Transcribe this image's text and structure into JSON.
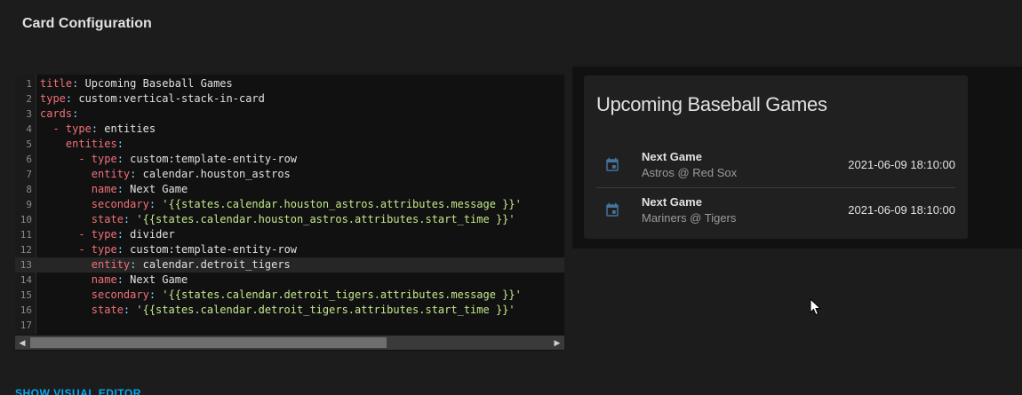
{
  "dialog": {
    "title": "Card Configuration"
  },
  "editor": {
    "lines": [
      {
        "n": "1",
        "tokens": [
          [
            "k",
            "title"
          ],
          [
            "p",
            ": "
          ],
          [
            "v",
            "Upcoming Baseball Games"
          ]
        ]
      },
      {
        "n": "2",
        "tokens": [
          [
            "k",
            "type"
          ],
          [
            "p",
            ": "
          ],
          [
            "v",
            "custom:vertical-stack-in-card"
          ]
        ]
      },
      {
        "n": "3",
        "tokens": [
          [
            "k",
            "cards"
          ],
          [
            "p",
            ":"
          ]
        ]
      },
      {
        "n": "4",
        "tokens": [
          [
            "v",
            "  "
          ],
          [
            "k",
            "- type"
          ],
          [
            "p",
            ": "
          ],
          [
            "v",
            "entities"
          ]
        ]
      },
      {
        "n": "5",
        "tokens": [
          [
            "v",
            "    "
          ],
          [
            "k",
            "entities"
          ],
          [
            "p",
            ":"
          ]
        ]
      },
      {
        "n": "6",
        "tokens": [
          [
            "v",
            "      "
          ],
          [
            "k",
            "- type"
          ],
          [
            "p",
            ": "
          ],
          [
            "v",
            "custom:template-entity-row"
          ]
        ]
      },
      {
        "n": "7",
        "tokens": [
          [
            "v",
            "        "
          ],
          [
            "k",
            "entity"
          ],
          [
            "p",
            ": "
          ],
          [
            "v",
            "calendar.houston_astros"
          ]
        ]
      },
      {
        "n": "8",
        "tokens": [
          [
            "v",
            "        "
          ],
          [
            "k",
            "name"
          ],
          [
            "p",
            ": "
          ],
          [
            "v",
            "Next Game"
          ]
        ]
      },
      {
        "n": "9",
        "tokens": [
          [
            "v",
            "        "
          ],
          [
            "k",
            "secondary"
          ],
          [
            "p",
            ": "
          ],
          [
            "s",
            "'{{states.calendar.houston_astros.attributes.message }}'"
          ]
        ]
      },
      {
        "n": "10",
        "tokens": [
          [
            "v",
            "        "
          ],
          [
            "k",
            "state"
          ],
          [
            "p",
            ": "
          ],
          [
            "s",
            "'{{states.calendar.houston_astros.attributes.start_time }}'"
          ]
        ]
      },
      {
        "n": "11",
        "tokens": [
          [
            "v",
            "      "
          ],
          [
            "k",
            "- type"
          ],
          [
            "p",
            ": "
          ],
          [
            "v",
            "divider"
          ]
        ]
      },
      {
        "n": "12",
        "tokens": [
          [
            "v",
            "      "
          ],
          [
            "k",
            "- type"
          ],
          [
            "p",
            ": "
          ],
          [
            "v",
            "custom:template-entity-row"
          ]
        ]
      },
      {
        "n": "13",
        "tokens": [
          [
            "v",
            "        "
          ],
          [
            "k",
            "entity"
          ],
          [
            "p",
            ": "
          ],
          [
            "v",
            "calendar.detroit_tigers"
          ]
        ],
        "active": true
      },
      {
        "n": "14",
        "tokens": [
          [
            "v",
            "        "
          ],
          [
            "k",
            "name"
          ],
          [
            "p",
            ": "
          ],
          [
            "v",
            "Next Game"
          ]
        ]
      },
      {
        "n": "15",
        "tokens": [
          [
            "v",
            "        "
          ],
          [
            "k",
            "secondary"
          ],
          [
            "p",
            ": "
          ],
          [
            "s",
            "'{{states.calendar.detroit_tigers.attributes.message }}'"
          ]
        ]
      },
      {
        "n": "16",
        "tokens": [
          [
            "v",
            "        "
          ],
          [
            "k",
            "state"
          ],
          [
            "p",
            ": "
          ],
          [
            "s",
            "'{{states.calendar.detroit_tigers.attributes.start_time }}'"
          ]
        ]
      },
      {
        "n": "17",
        "tokens": []
      }
    ]
  },
  "footer": {
    "show_visual_editor": "SHOW VISUAL EDITOR"
  },
  "preview": {
    "title": "Upcoming Baseball Games",
    "rows": [
      {
        "icon": "calendar-icon",
        "name": "Next Game",
        "secondary": "Astros @ Red Sox",
        "state": "2021-06-09 18:10:00"
      },
      {
        "icon": "calendar-icon",
        "name": "Next Game",
        "secondary": "Mariners @ Tigers",
        "state": "2021-06-09 18:10:00"
      }
    ],
    "icon_color": "#44739e"
  },
  "colors": {
    "key": "#f07178",
    "string": "#c3e88d",
    "link": "#03a9f4"
  }
}
